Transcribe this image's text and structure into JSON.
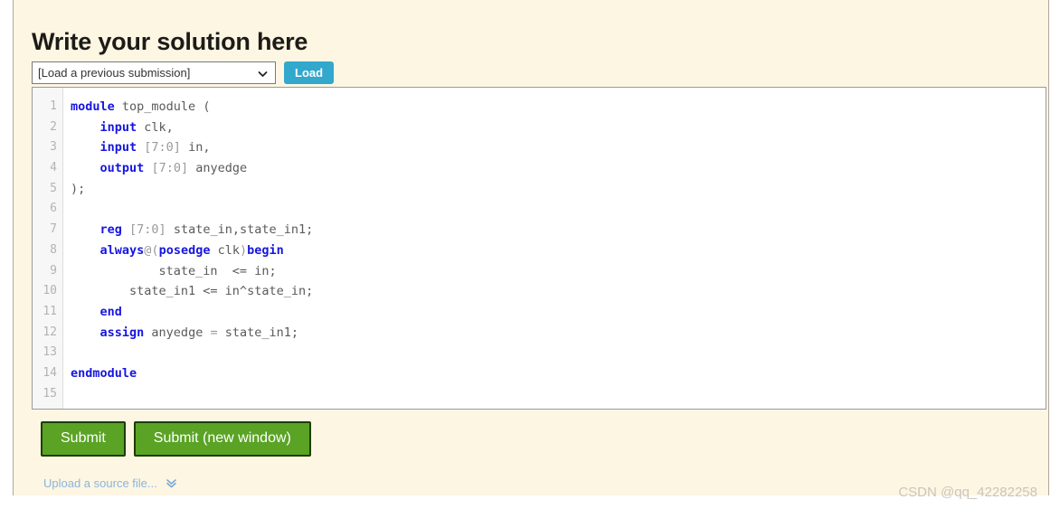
{
  "page": {
    "title": "Write your solution here",
    "background_color": "#fdf6e3",
    "border_color": "#b0aaa0"
  },
  "toolbar": {
    "select": {
      "selected_label": "[Load a previous submission]",
      "options": [
        "[Load a previous submission]"
      ],
      "icon": "chevron-down-icon"
    },
    "load_button": {
      "label": "Load",
      "color": "#31a8cc"
    }
  },
  "editor": {
    "line_numbers": [
      "1",
      "2",
      "3",
      "4",
      "5",
      "6",
      "7",
      "8",
      "9",
      "10",
      "11",
      "12",
      "13",
      "14",
      "15"
    ],
    "language": "verilog",
    "lines": [
      [
        {
          "t": "module",
          "c": "kw"
        },
        {
          "t": " top_module (",
          "c": "id"
        }
      ],
      [
        {
          "t": "    ",
          "c": "id"
        },
        {
          "t": "input",
          "c": "kw"
        },
        {
          "t": " clk,",
          "c": "id"
        }
      ],
      [
        {
          "t": "    ",
          "c": "id"
        },
        {
          "t": "input",
          "c": "kw"
        },
        {
          "t": " ",
          "c": "id"
        },
        {
          "t": "[7:0]",
          "c": "num"
        },
        {
          "t": " in,",
          "c": "id"
        }
      ],
      [
        {
          "t": "    ",
          "c": "id"
        },
        {
          "t": "output",
          "c": "kw"
        },
        {
          "t": " ",
          "c": "id"
        },
        {
          "t": "[7:0]",
          "c": "num"
        },
        {
          "t": " anyedge",
          "c": "id"
        }
      ],
      [
        {
          "t": ");",
          "c": "pn"
        }
      ],
      [],
      [
        {
          "t": "    ",
          "c": "id"
        },
        {
          "t": "reg",
          "c": "kw"
        },
        {
          "t": " ",
          "c": "id"
        },
        {
          "t": "[7:0]",
          "c": "num"
        },
        {
          "t": " state_in,state_in1;",
          "c": "id"
        }
      ],
      [
        {
          "t": "    ",
          "c": "id"
        },
        {
          "t": "always",
          "c": "kw"
        },
        {
          "t": "@(",
          "c": "op"
        },
        {
          "t": "posedge",
          "c": "kw"
        },
        {
          "t": " clk",
          "c": "id"
        },
        {
          "t": ")",
          "c": "op"
        },
        {
          "t": "begin",
          "c": "kw"
        }
      ],
      [
        {
          "t": "            state_in  <= in;",
          "c": "id"
        }
      ],
      [
        {
          "t": "        state_in1 <= in^state_in;",
          "c": "id"
        }
      ],
      [
        {
          "t": "    ",
          "c": "id"
        },
        {
          "t": "end",
          "c": "kw"
        }
      ],
      [
        {
          "t": "    ",
          "c": "id"
        },
        {
          "t": "assign",
          "c": "kw"
        },
        {
          "t": " anyedge ",
          "c": "id"
        },
        {
          "t": "=",
          "c": "op"
        },
        {
          "t": " state_in1;",
          "c": "id"
        }
      ],
      [],
      [
        {
          "t": "endmodule",
          "c": "kw"
        }
      ],
      []
    ]
  },
  "actions": {
    "submit_label": "Submit",
    "submit_new_window_label": "Submit (new window)",
    "button_color": "#5aa324",
    "button_border_color": "#1d3d05"
  },
  "upload": {
    "label": "Upload a source file...",
    "icon": "double-chevron-down-icon",
    "color": "#8ab4dd"
  },
  "watermark": {
    "text": "CSDN @qq_42282258"
  }
}
